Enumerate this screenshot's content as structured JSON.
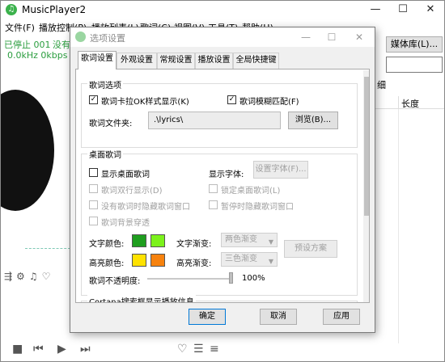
{
  "main": {
    "title": "MusicPlayer2",
    "menu": [
      "文件(F)",
      "播放控制(P)",
      "播放列表(L)",
      "歌词(C)",
      "视图(V)",
      "工具(T)",
      "帮助(H)"
    ],
    "status": "已停止 001",
    "status2": "没有",
    "bitrate": "0.0kHz 0kbps",
    "media_lib_button": "媒体库(L)...",
    "list_header_partial": "细",
    "length_header": "长度"
  },
  "dialog": {
    "title": "选项设置",
    "tabs": [
      "歌词设置",
      "外观设置",
      "常规设置",
      "播放设置",
      "全局快捷键"
    ],
    "lyric_group": {
      "label": "歌词选项",
      "karaoke": {
        "label": "歌词卡拉OK样式显示(K)",
        "checked": true
      },
      "fuzzy": {
        "label": "歌词模糊匹配(F)",
        "checked": true
      },
      "folder_label": "歌词文件夹:",
      "folder_value": ".\\lyrics\\",
      "browse": "浏览(B)..."
    },
    "desktop_group": {
      "label": "桌面歌词",
      "show": {
        "label": "显示桌面歌词",
        "checked": false
      },
      "font_label": "显示字体:",
      "font_button": "设置字体(F)...",
      "double_line": "歌词双行显示(D)",
      "lock": "锁定桌面歌词(L)",
      "hide_no_lyric": "没有歌词时隐藏歌词窗口",
      "hide_paused": "暂停时隐藏歌词窗口",
      "bg_through": "歌词背景穿透",
      "text_color_label": "文字颜色:",
      "text_gradient_label": "文字渐变:",
      "text_gradient_value": "两色渐变",
      "highlight_color_label": "高亮颜色:",
      "highlight_gradient_label": "高亮渐变:",
      "highlight_gradient_value": "三色渐变",
      "preset_button": "预设方案",
      "opacity_label": "歌词不透明度:",
      "opacity_value": "100%",
      "opacity": 1.0,
      "colors": {
        "text1": "#1f9e1f",
        "text2": "#7cf21c",
        "hl1": "#ffe200",
        "hl2": "#f7820e"
      }
    },
    "cortana_group": {
      "label": "Cortana搜索框显示播放信息"
    },
    "ok": "确定",
    "cancel": "取消",
    "apply": "应用"
  }
}
